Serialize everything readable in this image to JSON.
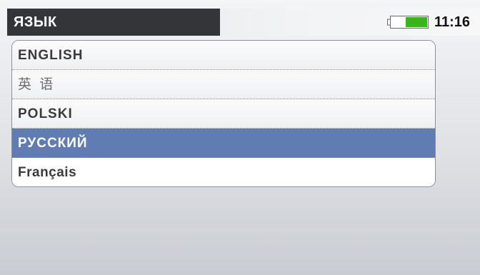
{
  "header": {
    "title": "ЯЗЫК",
    "time": "11:16",
    "battery_icon": "battery-icon",
    "battery_level": 0.6
  },
  "language_list": {
    "items": [
      {
        "label": "ENGLISH",
        "selected": false
      },
      {
        "label": "英 语",
        "selected": false
      },
      {
        "label": "POLSKI",
        "selected": false
      },
      {
        "label": "РУССКИЙ",
        "selected": true
      },
      {
        "label": "Français",
        "selected": false
      }
    ]
  },
  "colors": {
    "selection": "#5f7db3",
    "title_bar": "#343538",
    "battery_fill": "#35b814"
  }
}
